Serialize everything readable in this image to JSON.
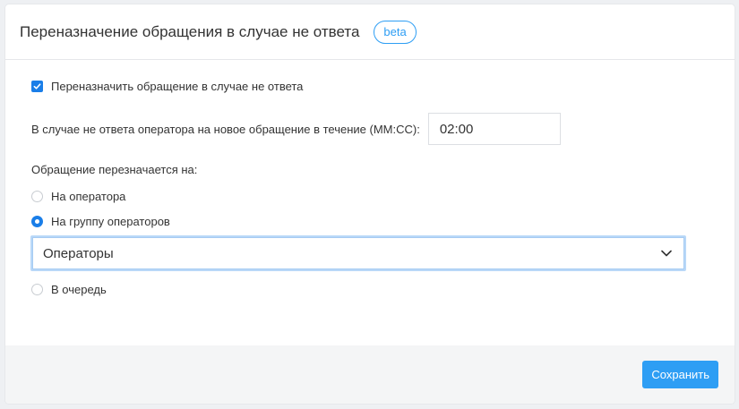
{
  "header": {
    "title": "Переназначение обращения в случае не ответа",
    "badge": "beta"
  },
  "reassign_checkbox": {
    "label": "Переназначить обращение в случае не ответа",
    "checked": true
  },
  "timeout": {
    "label": "В случае не ответа оператора на новое обращение в течение (ММ:СС):",
    "value": "02:00"
  },
  "reassign_to": {
    "label": "Обращение перезначается на:",
    "options": [
      {
        "label": "На оператора",
        "checked": false
      },
      {
        "label": "На группу операторов",
        "checked": true
      },
      {
        "label": "В очередь",
        "checked": false
      }
    ]
  },
  "group_select": {
    "value": "Операторы"
  },
  "footer": {
    "save_label": "Сохранить"
  },
  "colors": {
    "accent": "#2e9ef4",
    "checkbox": "#1a7ee8"
  }
}
